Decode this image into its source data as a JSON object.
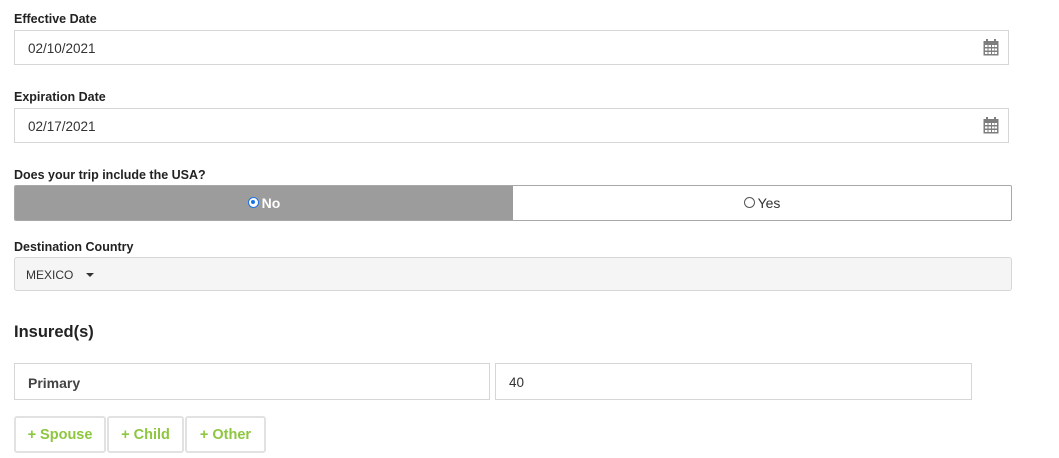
{
  "effective_date": {
    "label": "Effective Date",
    "value": "02/10/2021",
    "icon": "calendar-icon"
  },
  "expiration_date": {
    "label": "Expiration Date",
    "value": "02/17/2021",
    "icon": "calendar-icon"
  },
  "usa_trip": {
    "label": "Does your trip include the USA?",
    "options": [
      "No",
      "Yes"
    ],
    "selected": "No"
  },
  "destination": {
    "label": "Destination Country",
    "value": "MEXICO"
  },
  "insured": {
    "title": "Insured(s)",
    "primary_label": "Primary",
    "primary_age": "40"
  },
  "add_buttons": {
    "spouse": "+ Spouse",
    "child": "+ Child",
    "other": "+ Other"
  },
  "colors": {
    "accent_green": "#8dc63f",
    "selected_toggle": "#9c9c9c",
    "radio_blue": "#1a73e8"
  }
}
